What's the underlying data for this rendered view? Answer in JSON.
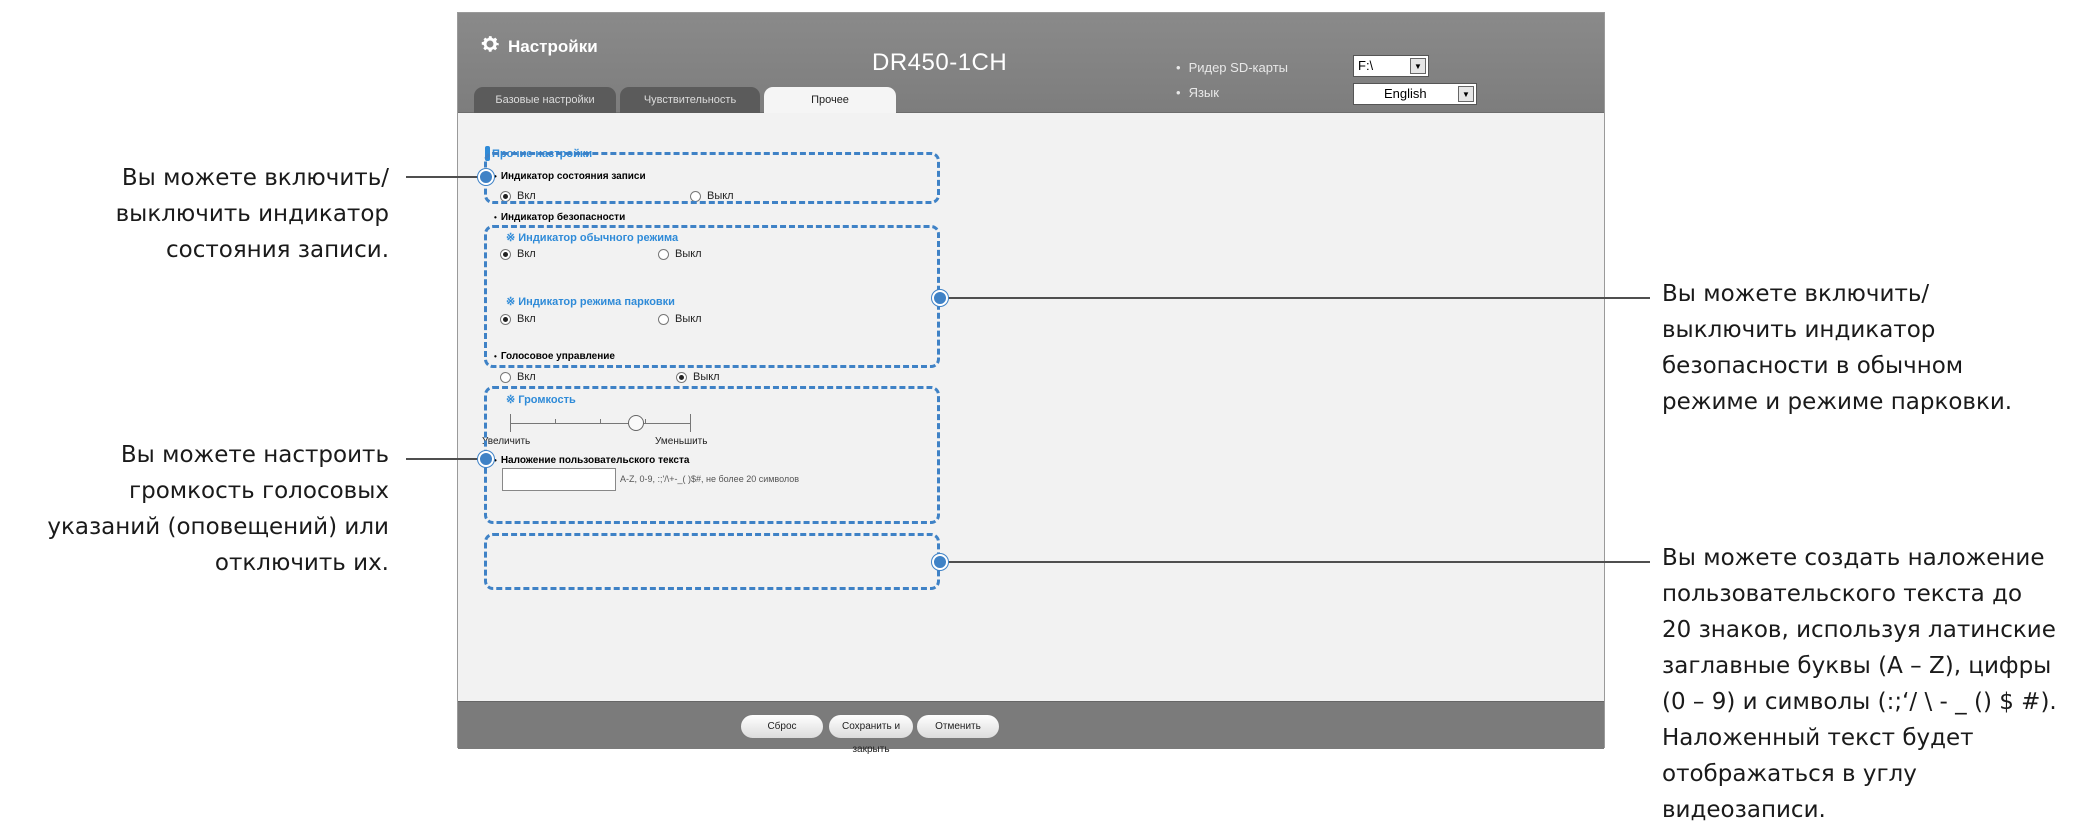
{
  "callouts": {
    "record_indicator": [
      "Вы можете включить/",
      "выключить индикатор",
      "состояния записи."
    ],
    "security_indicator": [
      "Вы можете включить/",
      "выключить индикатор",
      "безопасности в обычном",
      "режиме и режиме парковки."
    ],
    "voice_volume": [
      "Вы можете настроить",
      "громкость голосовых",
      "указаний (оповещений) или",
      "отключить их."
    ],
    "user_text": [
      "Вы можете создать наложение",
      "пользовательского текста до",
      "20 знаков, используя латинские",
      "заглавные буквы (A – Z), цифры",
      "(0 – 9) и символы (:;‘/ \\ - _ () $ #).",
      "Наложенный текст будет",
      "отображаться в углу",
      "видеозаписи."
    ]
  },
  "header": {
    "app_title": "Настройки",
    "device_title": "DR450-1CH",
    "sd_reader_label": "Ридер SD-карты",
    "sd_reader_value": "F:\\",
    "language_label": "Язык",
    "language_value": "English"
  },
  "tabs": [
    "Базовые настройки",
    "Чувствительность",
    "Прочее"
  ],
  "other_settings": {
    "section_title": "Прочие настройки",
    "record_indicator": {
      "label": "Индикатор состояния записи",
      "on": "Вкл",
      "off": "Выкл",
      "selected": "on"
    },
    "security_indicator": {
      "label": "Индикатор безопасности",
      "normal_label": "※ Индикатор обычного режима",
      "parking_label": "※ Индикатор режима парковки",
      "on": "Вкл",
      "off": "Выкл"
    },
    "voice_control": {
      "label": "Голосовое управление",
      "on": "Вкл",
      "off": "Выкл",
      "selected": "off",
      "volume_label": "※ Громкость",
      "increase": "Увеличить",
      "decrease": "Уменьшить",
      "volume_level": 0.7
    },
    "user_text": {
      "label": "Наложение пользовательского текста",
      "value": "",
      "hint": "A-Z, 0-9, :;'/\\+-_( )$#, не более 20 символов"
    }
  },
  "footer": {
    "reset": "Сброс",
    "save_close": "Сохранить и закрыть",
    "cancel": "Отменить"
  },
  "colors": {
    "accent": "#3f82c6",
    "header": "#7d7d7d",
    "link_blue": "#2f8bd8"
  }
}
